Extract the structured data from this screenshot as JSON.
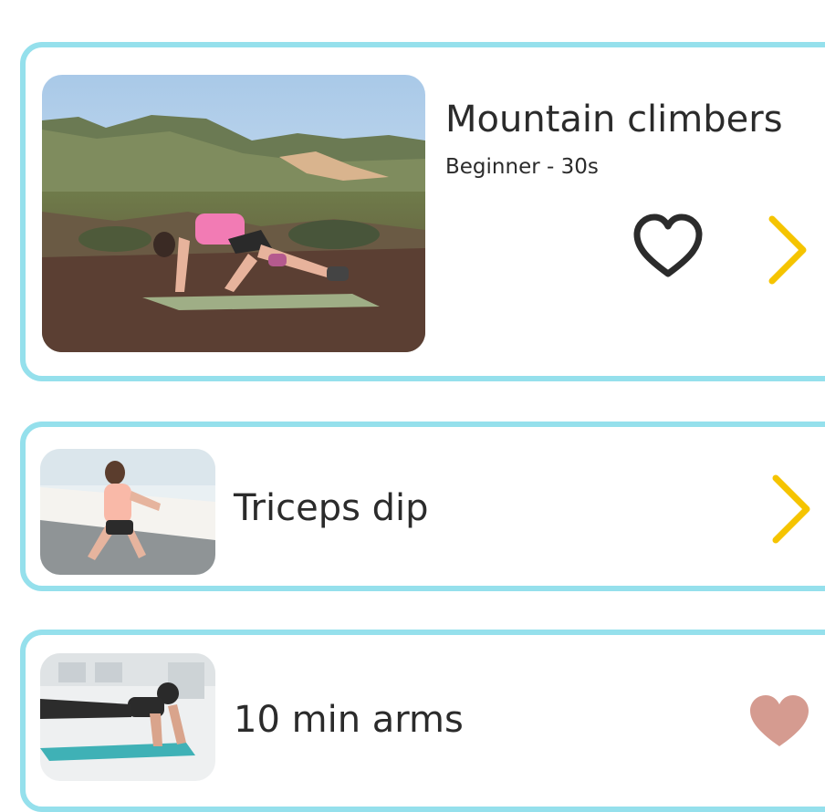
{
  "workouts": [
    {
      "title": "Mountain climbers",
      "subtitle": "Beginner - 30s",
      "favorite": false
    },
    {
      "title": "Triceps dip",
      "favorite": null
    },
    {
      "title": "10 min arms",
      "favorite": true
    }
  ],
  "colors": {
    "card_border": "#95e0ec",
    "chevron": "#f5c400",
    "heart_outline": "#2b2b2b",
    "heart_filled": "#d59b90",
    "text": "#2b2b2b"
  },
  "icons": {
    "favorite_outline": "heart-outline-icon",
    "favorite_filled": "heart-filled-icon",
    "next": "chevron-right-icon"
  }
}
